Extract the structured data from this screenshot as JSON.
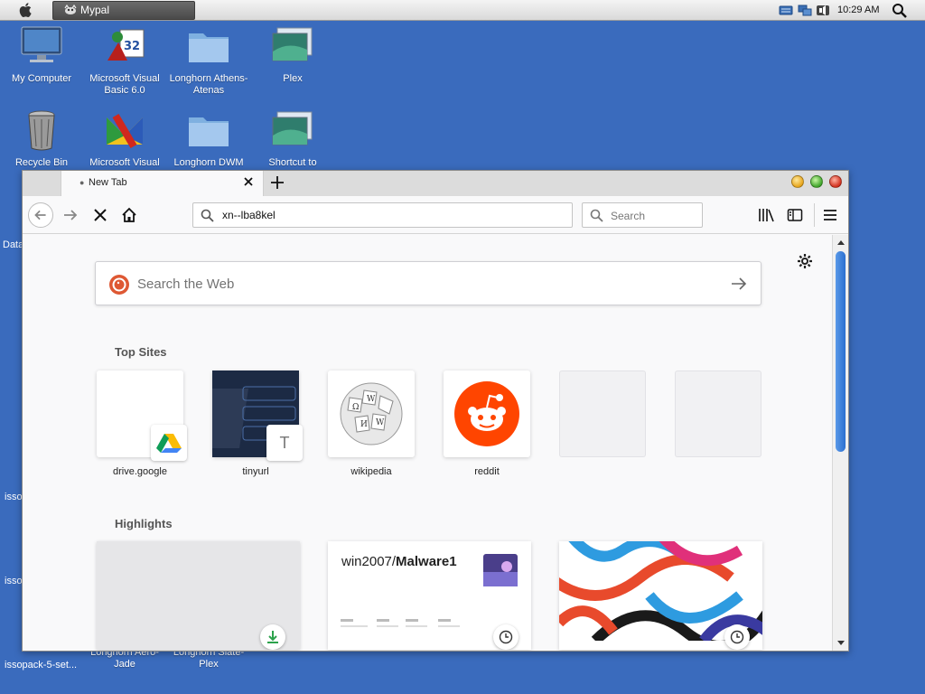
{
  "menubar": {
    "active_task": "Mypal",
    "clock": "10:29 AM"
  },
  "desktop": {
    "icons": [
      {
        "label": "My Computer"
      },
      {
        "label": "Microsoft Visual Basic 6.0"
      },
      {
        "label": "Longhorn Athens-Atenas"
      },
      {
        "label": "Plex"
      },
      {
        "label": "Recycle Bin"
      },
      {
        "label": "Microsoft Visual"
      },
      {
        "label": "Longhorn DWM"
      },
      {
        "label": "Shortcut to"
      },
      {
        "label": "Longhorn Aero-Jade"
      },
      {
        "label": "Longhorn Slate-Plex"
      }
    ],
    "edge_labels": [
      "Data",
      "isso",
      "isso",
      "issopack-5-set..."
    ]
  },
  "browser": {
    "tab": {
      "title": "New Tab"
    },
    "url": "xn--lba8kel",
    "search_placeholder": "Search",
    "web_search_placeholder": "Search the Web",
    "top_sites_title": "Top Sites",
    "top_sites": [
      {
        "label": "drive.google"
      },
      {
        "label": "tinyurl",
        "badge_letter": "T"
      },
      {
        "label": "wikipedia"
      },
      {
        "label": "reddit"
      },
      {
        "label": ""
      },
      {
        "label": ""
      }
    ],
    "highlights_title": "Highlights",
    "highlights": [
      {
        "title": ""
      },
      {
        "title_prefix": "win2007/",
        "title_bold": "Malware1"
      },
      {
        "title": ""
      }
    ]
  },
  "colors": {
    "desktop": "#3a6bbd",
    "reddit": "#ff4500",
    "scroll_thumb": "#2b6fd0"
  }
}
